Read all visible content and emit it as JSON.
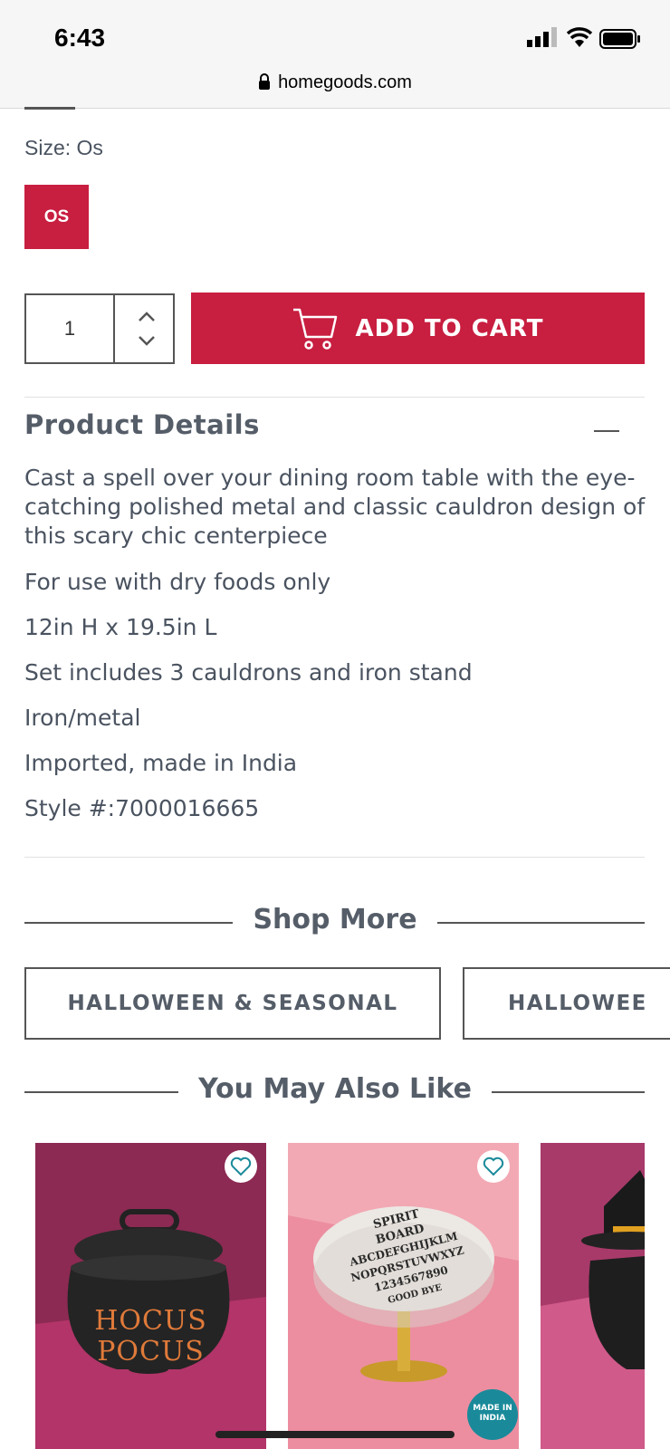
{
  "status_bar": {
    "time": "6:43",
    "url": "homegoods.com"
  },
  "size": {
    "label": "Size:  Os",
    "option": "OS"
  },
  "quantity": {
    "value": "1"
  },
  "cart": {
    "button_label": "ADD TO CART"
  },
  "product_details": {
    "title": "Product Details",
    "description": "Cast a spell over your dining room table with the eye-catching polished metal and classic cauldron design of this scary chic centerpiece",
    "specs": [
      "For use with dry foods only",
      "12in H x 19.5in L",
      "Set includes 3 cauldrons and iron stand",
      "Iron/metal",
      "Imported, made in India",
      "Style #:7000016665"
    ]
  },
  "shop_more": {
    "title": "Shop More",
    "chips": [
      "HALLOWEEN & SEASONAL",
      "HALLOWEE"
    ]
  },
  "recommendations": {
    "title": "You May Also Like",
    "items": [
      {
        "image_text": [
          "HOCUS",
          "POCUS"
        ]
      },
      {
        "image_text": [
          "SPIRIT",
          "BOARD",
          "ABCDEFGHIJKLM",
          "NOPQRSTUVWXYZ",
          "1234567890",
          "GOOD BYE"
        ],
        "badge": [
          "MADE IN",
          "INDIA"
        ]
      },
      {
        "image_text": []
      }
    ]
  },
  "colors": {
    "brand": "#c81e40",
    "text": "#4a5360"
  }
}
